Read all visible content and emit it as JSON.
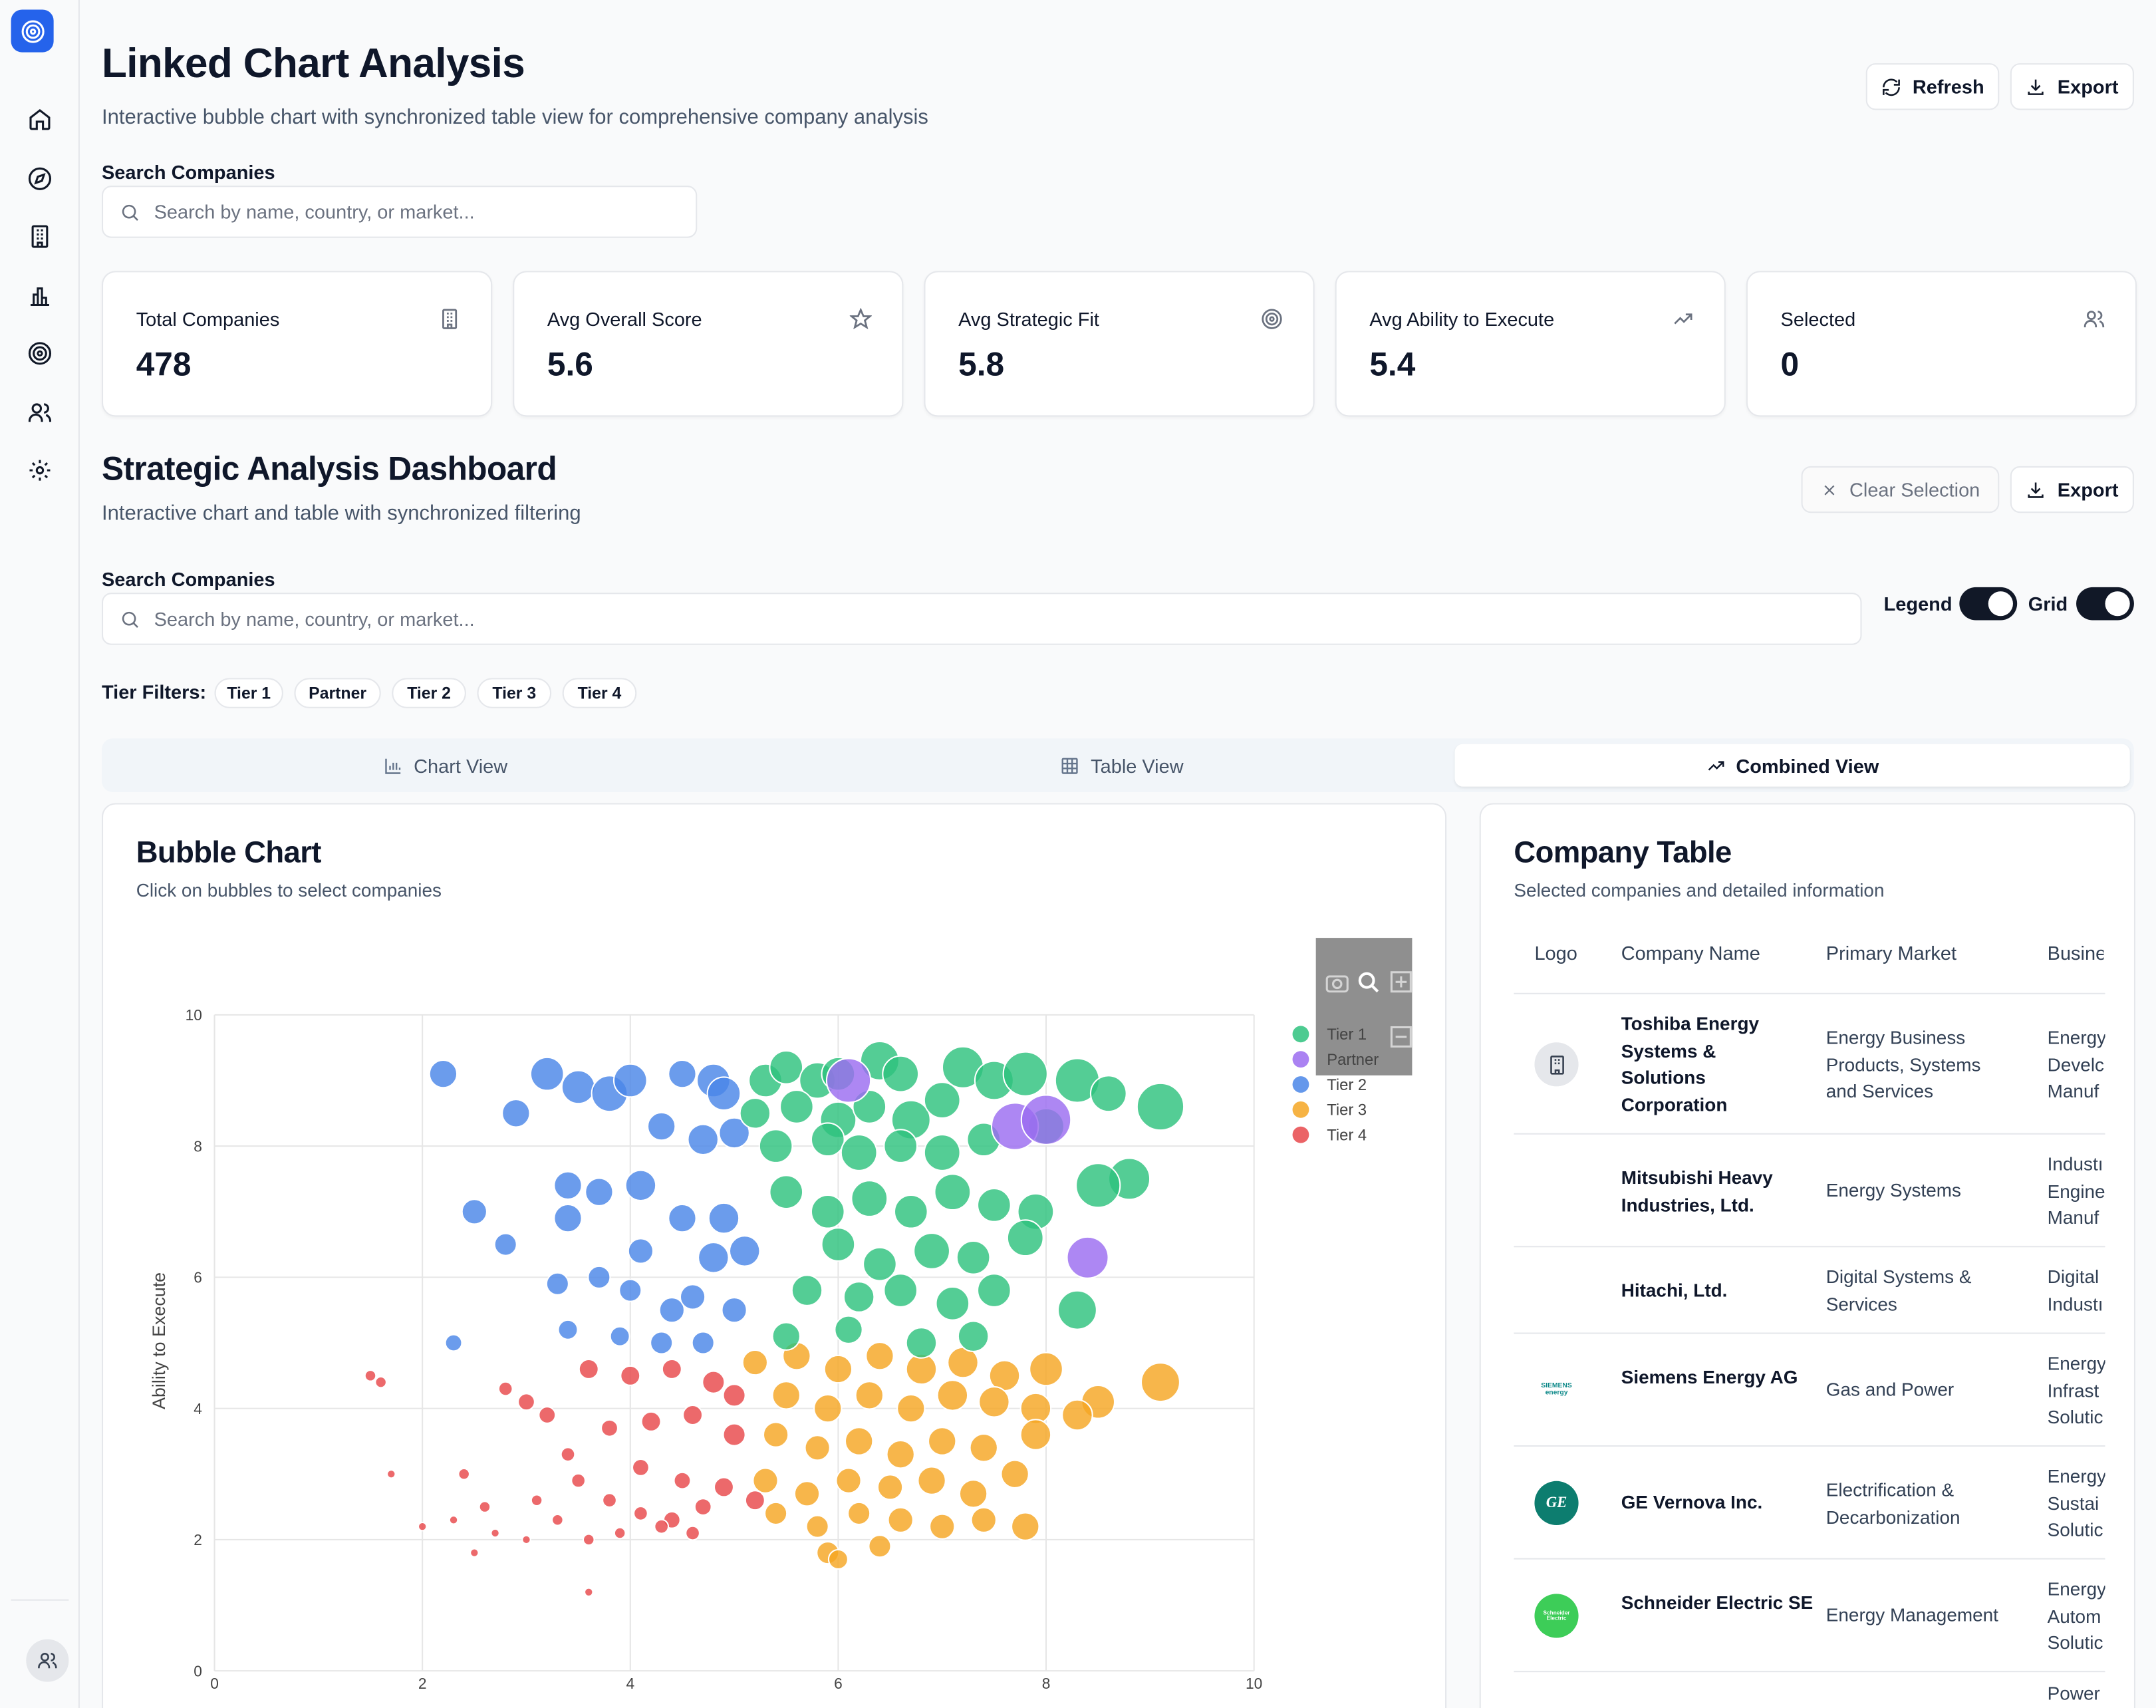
{
  "header": {
    "title": "Linked Chart Analysis",
    "subtitle": "Interactive bubble chart with synchronized table view for comprehensive company analysis",
    "refresh_label": "Refresh",
    "export_label": "Export"
  },
  "top_search": {
    "label": "Search Companies",
    "placeholder": "Search by name, country, or market..."
  },
  "stats": [
    {
      "label": "Total Companies",
      "value": "478",
      "icon": "building-icon"
    },
    {
      "label": "Avg Overall Score",
      "value": "5.6",
      "icon": "star-icon"
    },
    {
      "label": "Avg Strategic Fit",
      "value": "5.8",
      "icon": "target-icon"
    },
    {
      "label": "Avg Ability to Execute",
      "value": "5.4",
      "icon": "trending-up-icon"
    },
    {
      "label": "Selected",
      "value": "0",
      "icon": "users-icon"
    }
  ],
  "dashboard": {
    "title": "Strategic Analysis Dashboard",
    "subtitle": "Interactive chart and table with synchronized filtering",
    "clear_label": "Clear Selection",
    "export_label": "Export",
    "search_label": "Search Companies",
    "search_placeholder": "Search by name, country, or market...",
    "legend_label": "Legend",
    "grid_label": "Grid",
    "legend_on": true,
    "grid_on": true,
    "tier_filters_label": "Tier Filters:",
    "tier_filters": [
      "Tier 1",
      "Partner",
      "Tier 2",
      "Tier 3",
      "Tier 4"
    ]
  },
  "tabs": [
    {
      "label": "Chart View",
      "active": false
    },
    {
      "label": "Table View",
      "active": false
    },
    {
      "label": "Combined View",
      "active": true
    }
  ],
  "bubble_panel": {
    "title": "Bubble Chart",
    "subtitle": "Click on bubbles to select companies"
  },
  "table_panel": {
    "title": "Company Table",
    "subtitle": "Selected companies and detailed information",
    "columns": [
      "Logo",
      "Company Name",
      "Primary Market",
      "Busine"
    ],
    "rows": [
      {
        "name": "Toshiba Energy Systems & Solutions Corporation",
        "market": "Energy Business Products, Systems and Services",
        "business": "Energy Develc Manuf",
        "logo": "building-icon"
      },
      {
        "name": "Mitsubishi Heavy Industries, Ltd.",
        "market": "Energy Systems",
        "business": "Industı Engine Manuf",
        "logo": ""
      },
      {
        "name": "Hitachi, Ltd.",
        "market": "Digital Systems & Services",
        "business": "Digital Industı",
        "logo": ""
      },
      {
        "name": "Siemens Energy AG",
        "market": "Gas and Power",
        "business": "Energy Infrast Solutic",
        "logo": "SIEMENS energy"
      },
      {
        "name": "GE Vernova Inc.",
        "market": "Electrification & Decarbonization",
        "business": "Energy Sustai Solutic",
        "logo": "GE"
      },
      {
        "name": "Schneider Electric SE",
        "market": "Energy Management",
        "business": "Energy Autom Solutic",
        "logo": "Schneider Electric"
      },
      {
        "name": "",
        "market": "",
        "business": "Power",
        "logo": ""
      }
    ]
  },
  "colors": {
    "tier1": "#2ec27e",
    "partner": "#9b6cf0",
    "tier2": "#4a86e8",
    "tier3": "#f5a623",
    "tier4": "#e8484b",
    "accent": "#2563eb"
  },
  "chart_data": {
    "type": "scatter",
    "ylabel": "Ability to Execute",
    "xlabel": "",
    "xlim": [
      0,
      10
    ],
    "ylim": [
      0,
      10
    ],
    "xticks": [
      "0",
      "2",
      "4",
      "6",
      "8",
      "10"
    ],
    "yticks": [
      "0",
      "2",
      "4",
      "6",
      "8",
      "10"
    ],
    "grid": true,
    "legend_position": "top-right",
    "legend": [
      "Tier 1",
      "Partner",
      "Tier 2",
      "Tier 3",
      "Tier 4"
    ],
    "series": [
      {
        "name": "Tier 1",
        "points": [
          [
            5.3,
            9.0,
            12
          ],
          [
            5.5,
            9.2,
            12
          ],
          [
            5.8,
            9.0,
            13
          ],
          [
            6.0,
            9.1,
            12
          ],
          [
            6.4,
            9.3,
            14
          ],
          [
            6.6,
            9.1,
            13
          ],
          [
            7.2,
            9.2,
            15
          ],
          [
            7.5,
            9.0,
            14
          ],
          [
            7.8,
            9.1,
            16
          ],
          [
            8.3,
            9.0,
            16
          ],
          [
            9.1,
            8.6,
            17
          ],
          [
            8.6,
            8.8,
            13
          ],
          [
            5.2,
            8.5,
            11
          ],
          [
            5.6,
            8.6,
            12
          ],
          [
            6.0,
            8.4,
            13
          ],
          [
            6.3,
            8.6,
            12
          ],
          [
            6.7,
            8.4,
            14
          ],
          [
            7.0,
            8.7,
            13
          ],
          [
            5.4,
            8.0,
            12
          ],
          [
            5.9,
            8.1,
            12
          ],
          [
            6.2,
            7.9,
            13
          ],
          [
            6.6,
            8.0,
            12
          ],
          [
            7.0,
            7.9,
            13
          ],
          [
            7.4,
            8.1,
            12
          ],
          [
            8.0,
            8.3,
            13
          ],
          [
            8.8,
            7.5,
            15
          ],
          [
            8.5,
            7.4,
            16
          ],
          [
            5.5,
            7.3,
            12
          ],
          [
            5.9,
            7.0,
            12
          ],
          [
            6.3,
            7.2,
            13
          ],
          [
            6.7,
            7.0,
            12
          ],
          [
            7.1,
            7.3,
            13
          ],
          [
            7.5,
            7.1,
            12
          ],
          [
            7.9,
            7.0,
            13
          ],
          [
            6.0,
            6.5,
            12
          ],
          [
            6.4,
            6.2,
            12
          ],
          [
            6.9,
            6.4,
            13
          ],
          [
            7.3,
            6.3,
            12
          ],
          [
            7.8,
            6.6,
            13
          ],
          [
            5.7,
            5.8,
            11
          ],
          [
            6.2,
            5.7,
            11
          ],
          [
            6.6,
            5.8,
            12
          ],
          [
            7.1,
            5.6,
            12
          ],
          [
            7.5,
            5.8,
            12
          ],
          [
            8.3,
            5.5,
            14
          ],
          [
            5.5,
            5.1,
            10
          ],
          [
            6.1,
            5.2,
            10
          ],
          [
            6.8,
            5.0,
            11
          ],
          [
            7.3,
            5.1,
            11
          ]
        ]
      },
      {
        "name": "Partner",
        "points": [
          [
            6.1,
            9.0,
            16
          ],
          [
            7.7,
            8.3,
            17
          ],
          [
            8.0,
            8.4,
            18
          ],
          [
            8.4,
            6.3,
            15
          ]
        ]
      },
      {
        "name": "Tier 2",
        "points": [
          [
            2.2,
            9.1,
            10
          ],
          [
            3.2,
            9.1,
            12
          ],
          [
            3.5,
            8.9,
            12
          ],
          [
            3.8,
            8.8,
            13
          ],
          [
            4.0,
            9.0,
            12
          ],
          [
            4.5,
            9.1,
            10
          ],
          [
            4.8,
            9.0,
            12
          ],
          [
            4.9,
            8.8,
            12
          ],
          [
            2.9,
            8.5,
            10
          ],
          [
            4.3,
            8.3,
            10
          ],
          [
            4.7,
            8.1,
            11
          ],
          [
            5.0,
            8.2,
            11
          ],
          [
            3.4,
            7.4,
            10
          ],
          [
            4.1,
            7.4,
            11
          ],
          [
            3.7,
            7.3,
            10
          ],
          [
            2.5,
            7.0,
            9
          ],
          [
            3.4,
            6.9,
            10
          ],
          [
            4.5,
            6.9,
            10
          ],
          [
            4.9,
            6.9,
            11
          ],
          [
            2.8,
            6.5,
            8
          ],
          [
            4.1,
            6.4,
            9
          ],
          [
            4.8,
            6.3,
            11
          ],
          [
            5.1,
            6.4,
            11
          ],
          [
            3.3,
            5.9,
            8
          ],
          [
            3.7,
            6.0,
            8
          ],
          [
            4.0,
            5.8,
            8
          ],
          [
            4.4,
            5.5,
            9
          ],
          [
            4.6,
            5.7,
            9
          ],
          [
            5.0,
            5.5,
            9
          ],
          [
            3.4,
            5.2,
            7
          ],
          [
            3.9,
            5.1,
            7
          ],
          [
            4.3,
            5.0,
            8
          ],
          [
            4.7,
            5.0,
            8
          ],
          [
            2.3,
            5.0,
            6
          ]
        ]
      },
      {
        "name": "Tier 3",
        "points": [
          [
            5.2,
            4.7,
            9
          ],
          [
            5.6,
            4.8,
            10
          ],
          [
            6.0,
            4.6,
            10
          ],
          [
            6.4,
            4.8,
            10
          ],
          [
            6.8,
            4.6,
            11
          ],
          [
            7.2,
            4.7,
            11
          ],
          [
            7.6,
            4.5,
            11
          ],
          [
            8.0,
            4.6,
            12
          ],
          [
            8.5,
            4.1,
            12
          ],
          [
            9.1,
            4.4,
            14
          ],
          [
            5.5,
            4.2,
            10
          ],
          [
            5.9,
            4.0,
            10
          ],
          [
            6.3,
            4.2,
            10
          ],
          [
            6.7,
            4.0,
            10
          ],
          [
            7.1,
            4.2,
            11
          ],
          [
            7.5,
            4.1,
            11
          ],
          [
            7.9,
            4.0,
            11
          ],
          [
            8.3,
            3.9,
            11
          ],
          [
            5.4,
            3.6,
            9
          ],
          [
            5.8,
            3.4,
            9
          ],
          [
            6.2,
            3.5,
            10
          ],
          [
            6.6,
            3.3,
            10
          ],
          [
            7.0,
            3.5,
            10
          ],
          [
            7.4,
            3.4,
            10
          ],
          [
            7.9,
            3.6,
            11
          ],
          [
            5.3,
            2.9,
            9
          ],
          [
            5.7,
            2.7,
            9
          ],
          [
            6.1,
            2.9,
            9
          ],
          [
            6.5,
            2.8,
            9
          ],
          [
            6.9,
            2.9,
            10
          ],
          [
            7.3,
            2.7,
            10
          ],
          [
            7.7,
            3.0,
            10
          ],
          [
            5.4,
            2.4,
            8
          ],
          [
            5.8,
            2.2,
            8
          ],
          [
            6.2,
            2.4,
            8
          ],
          [
            6.6,
            2.3,
            9
          ],
          [
            7.0,
            2.2,
            9
          ],
          [
            7.4,
            2.3,
            9
          ],
          [
            7.8,
            2.2,
            10
          ],
          [
            5.9,
            1.8,
            8
          ],
          [
            6.4,
            1.9,
            8
          ],
          [
            6.0,
            1.7,
            7
          ]
        ]
      },
      {
        "name": "Tier 4",
        "points": [
          [
            1.5,
            4.5,
            4
          ],
          [
            1.6,
            4.4,
            4
          ],
          [
            3.0,
            4.1,
            6
          ],
          [
            2.8,
            4.3,
            5
          ],
          [
            3.6,
            4.6,
            7
          ],
          [
            4.0,
            4.5,
            7
          ],
          [
            4.4,
            4.6,
            7
          ],
          [
            4.8,
            4.4,
            8
          ],
          [
            5.0,
            4.2,
            8
          ],
          [
            3.2,
            3.9,
            6
          ],
          [
            3.8,
            3.7,
            6
          ],
          [
            4.2,
            3.8,
            7
          ],
          [
            4.6,
            3.9,
            7
          ],
          [
            5.0,
            3.6,
            8
          ],
          [
            3.4,
            3.3,
            5
          ],
          [
            4.1,
            3.1,
            6
          ],
          [
            4.5,
            2.9,
            6
          ],
          [
            4.9,
            2.8,
            7
          ],
          [
            5.2,
            2.6,
            7
          ],
          [
            3.5,
            2.9,
            5
          ],
          [
            3.8,
            2.6,
            5
          ],
          [
            4.1,
            2.4,
            5
          ],
          [
            4.4,
            2.3,
            6
          ],
          [
            4.7,
            2.5,
            6
          ],
          [
            3.1,
            2.6,
            4
          ],
          [
            3.3,
            2.3,
            4
          ],
          [
            3.6,
            2.0,
            4
          ],
          [
            3.9,
            2.1,
            4
          ],
          [
            4.3,
            2.2,
            5
          ],
          [
            4.6,
            2.1,
            5
          ],
          [
            2.4,
            3.0,
            4
          ],
          [
            2.6,
            2.5,
            4
          ],
          [
            2.7,
            2.1,
            3
          ],
          [
            3.0,
            2.0,
            3
          ],
          [
            2.3,
            2.3,
            3
          ],
          [
            1.7,
            3.0,
            3
          ],
          [
            3.6,
            1.2,
            3
          ],
          [
            2.5,
            1.8,
            3
          ],
          [
            2.0,
            2.2,
            3
          ]
        ]
      }
    ]
  }
}
